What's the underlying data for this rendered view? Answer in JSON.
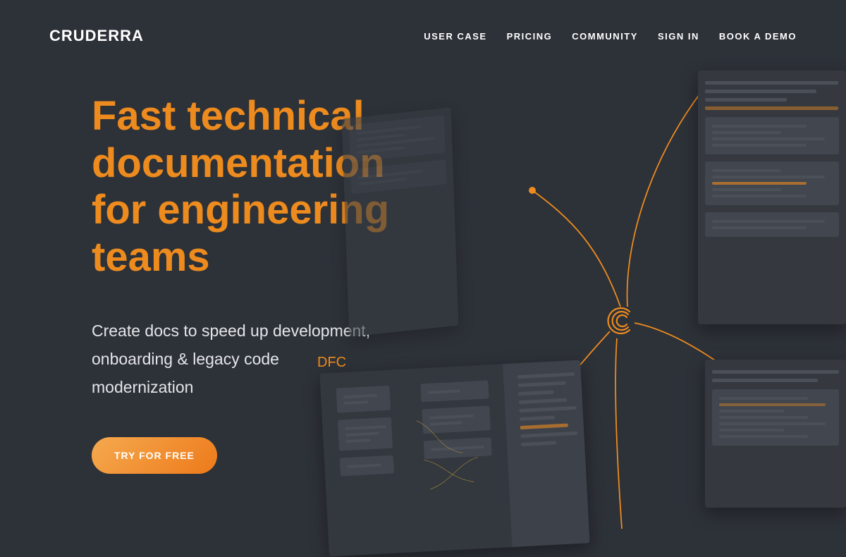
{
  "brand": {
    "name": "CRUDERRA"
  },
  "nav": {
    "items": [
      {
        "label": "USER CASE"
      },
      {
        "label": "PRICING"
      },
      {
        "label": "COMMUNITY"
      },
      {
        "label": "SIGN IN"
      },
      {
        "label": "BOOK A DEMO"
      }
    ]
  },
  "hero": {
    "title": "Fast technical documentation for engineering teams",
    "subtitle": "Create docs to speed up development, onboarding & legacy code modernization",
    "cta_label": "TRY FOR FREE"
  },
  "illustration": {
    "label": "DFC"
  },
  "colors": {
    "accent": "#ed8b1e",
    "bg": "#2d3138"
  }
}
